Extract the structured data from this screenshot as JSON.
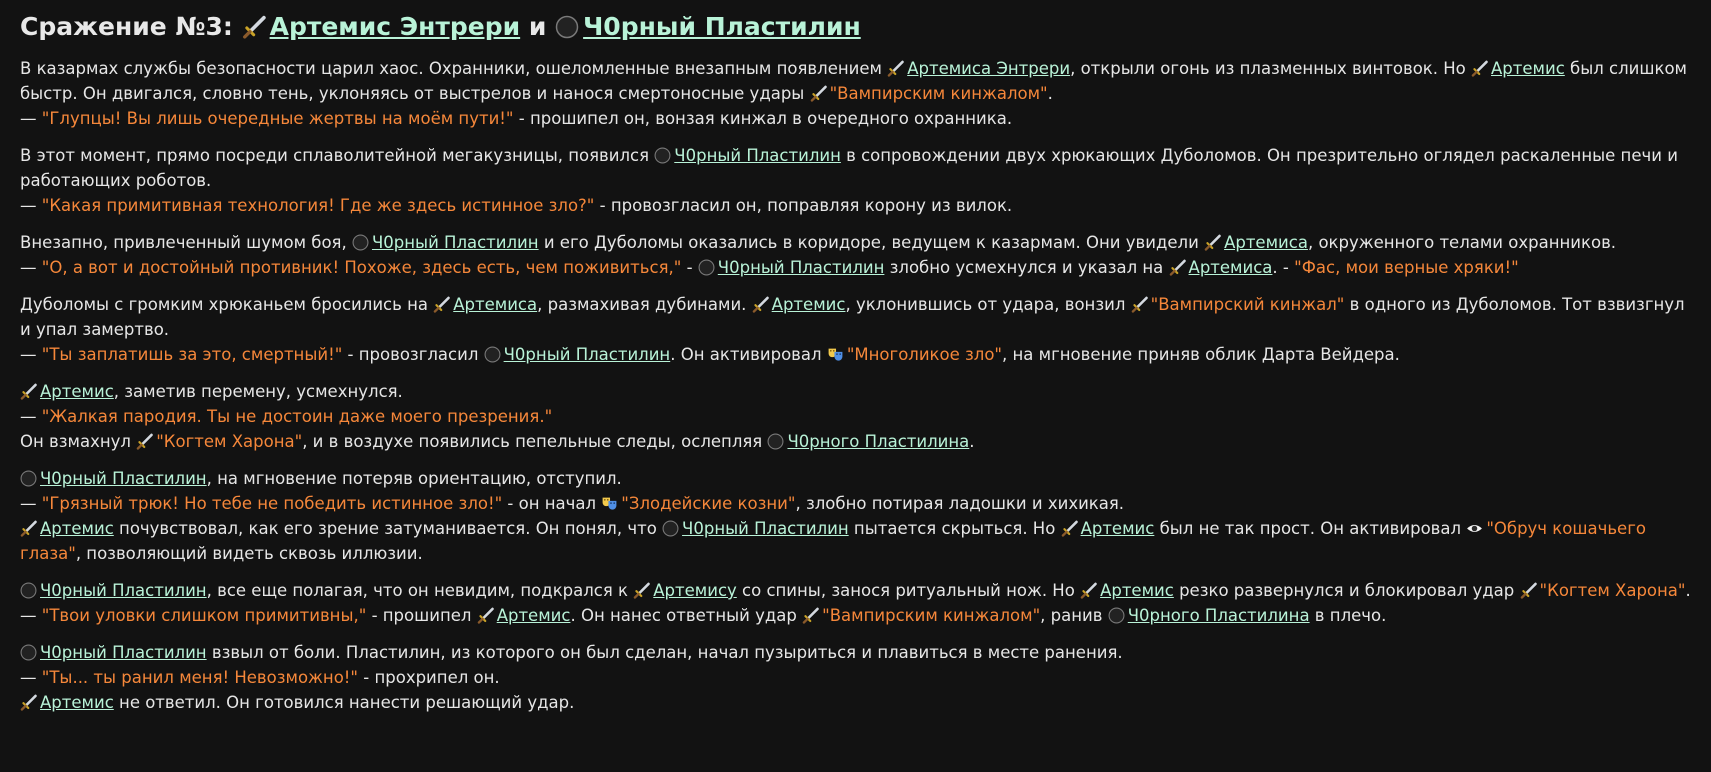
{
  "title": {
    "prefix": "Сражение №3:",
    "hero": "Артемис Энтрери",
    "and": "и",
    "villain": "Ч0рный Пластилин"
  },
  "paragraphs": [
    [
      [
        {
          "t": "В казармах службы безопасности царил хаос. Охранники, ошеломленные внезапным появлением "
        },
        {
          "t": "Артемиса Энтрери",
          "k": "link",
          "i": "dagger-icon"
        },
        {
          "t": ", открыли огонь из плазменных винтовок. Но "
        },
        {
          "t": "Артемис",
          "k": "link",
          "i": "dagger-icon"
        },
        {
          "t": " был слишком быстр. Он двигался, словно тень, уклоняясь от выстрелов и нанося смертоносные удары "
        },
        {
          "t": "\"Вампирским кинжалом\"",
          "k": "q",
          "i": "dagger-icon"
        },
        {
          "t": "."
        }
      ],
      [
        {
          "t": "— "
        },
        {
          "t": "\"Глупцы! Вы лишь очередные жертвы на моём пути!\"",
          "k": "q"
        },
        {
          "t": " - прошипел он, вонзая кинжал в очередного охранника."
        }
      ]
    ],
    [
      [
        {
          "t": "В этот момент, прямо посреди сплаволитейной мегакузницы, появился "
        },
        {
          "t": "Ч0рный Пластилин",
          "k": "link",
          "i": "black-circle-icon"
        },
        {
          "t": " в сопровождении двух хрюкающих Дуболомов. Он презрительно оглядел раскаленные печи и работающих роботов."
        }
      ],
      [
        {
          "t": "— "
        },
        {
          "t": "\"Какая примитивная технология! Где же здесь истинное зло?\"",
          "k": "q"
        },
        {
          "t": " - провозгласил он, поправляя корону из вилок."
        }
      ]
    ],
    [
      [
        {
          "t": "Внезапно, привлеченный шумом боя, "
        },
        {
          "t": "Ч0рный Пластилин",
          "k": "link",
          "i": "black-circle-icon"
        },
        {
          "t": " и его Дуболомы оказались в коридоре, ведущем к казармам. Они увидели "
        },
        {
          "t": "Артемиса",
          "k": "link",
          "i": "dagger-icon"
        },
        {
          "t": ", окруженного телами охранников."
        }
      ],
      [
        {
          "t": "— "
        },
        {
          "t": "\"О, а вот и достойный противник! Похоже, здесь есть, чем поживиться,\"",
          "k": "q"
        },
        {
          "t": " - "
        },
        {
          "t": "Ч0рный Пластилин",
          "k": "link",
          "i": "black-circle-icon"
        },
        {
          "t": " злобно усмехнулся и указал на "
        },
        {
          "t": "Артемиса",
          "k": "link",
          "i": "dagger-icon"
        },
        {
          "t": ". - "
        },
        {
          "t": "\"Фас, мои верные хряки!\"",
          "k": "q"
        }
      ]
    ],
    [
      [
        {
          "t": "Дуболомы с громким хрюканьем бросились на "
        },
        {
          "t": "Артемиса",
          "k": "link",
          "i": "dagger-icon"
        },
        {
          "t": ", размахивая дубинами. "
        },
        {
          "t": "Артемис",
          "k": "link",
          "i": "dagger-icon"
        },
        {
          "t": ", уклонившись от удара, вонзил "
        },
        {
          "t": "\"Вампирский кинжал\"",
          "k": "q",
          "i": "dagger-icon"
        },
        {
          "t": " в одного из Дуболомов. Тот взвизгнул и упал замертво."
        }
      ],
      [
        {
          "t": "— "
        },
        {
          "t": "\"Ты заплатишь за это, смертный!\"",
          "k": "q"
        },
        {
          "t": " - провозгласил "
        },
        {
          "t": "Ч0рный Пластилин",
          "k": "link",
          "i": "black-circle-icon"
        },
        {
          "t": ". Он активировал "
        },
        {
          "t": "\"Многоликое зло\"",
          "k": "q",
          "i": "theater-masks-icon"
        },
        {
          "t": ", на мгновение приняв облик Дарта Вейдера."
        }
      ]
    ],
    [
      [
        {
          "t": "Артемис",
          "k": "link",
          "i": "dagger-icon"
        },
        {
          "t": ", заметив перемену, усмехнулся."
        }
      ],
      [
        {
          "t": "— "
        },
        {
          "t": "\"Жалкая пародия. Ты не достоин даже моего презрения.\"",
          "k": "q"
        }
      ],
      [
        {
          "t": "Он взмахнул "
        },
        {
          "t": "\"Когтем Харона\"",
          "k": "q",
          "i": "dagger-icon"
        },
        {
          "t": ", и в воздухе появились пепельные следы, ослепляя "
        },
        {
          "t": "Ч0рного Пластилина",
          "k": "link",
          "i": "black-circle-icon"
        },
        {
          "t": "."
        }
      ]
    ],
    [
      [
        {
          "t": "Ч0рный Пластилин",
          "k": "link",
          "i": "black-circle-icon"
        },
        {
          "t": ", на мгновение потеряв ориентацию, отступил."
        }
      ],
      [
        {
          "t": "— "
        },
        {
          "t": "\"Грязный трюк! Но тебе не победить истинное зло!\"",
          "k": "q"
        },
        {
          "t": " - он начал "
        },
        {
          "t": "\"Злодейские козни\"",
          "k": "q",
          "i": "theater-masks-icon"
        },
        {
          "t": ", злобно потирая ладошки и хихикая."
        }
      ],
      [
        {
          "t": "Артемис",
          "k": "link",
          "i": "dagger-icon"
        },
        {
          "t": " почувствовал, как его зрение затуманивается. Он понял, что "
        },
        {
          "t": "Ч0рный Пластилин",
          "k": "link",
          "i": "black-circle-icon"
        },
        {
          "t": " пытается скрыться. Но "
        },
        {
          "t": "Артемис",
          "k": "link",
          "i": "dagger-icon"
        },
        {
          "t": " был не так прост. Он активировал "
        },
        {
          "t": "\"Обруч кошачьего глаза\"",
          "k": "q",
          "i": "eye-icon"
        },
        {
          "t": ", позволяющий видеть сквозь иллюзии."
        }
      ]
    ],
    [
      [
        {
          "t": "Ч0рный Пластилин",
          "k": "link",
          "i": "black-circle-icon"
        },
        {
          "t": ", все еще полагая, что он невидим, подкрался к "
        },
        {
          "t": "Артемису",
          "k": "link",
          "i": "dagger-icon"
        },
        {
          "t": " со спины, занося ритуальный нож. Но "
        },
        {
          "t": "Артемис",
          "k": "link",
          "i": "dagger-icon"
        },
        {
          "t": " резко развернулся и блокировал удар "
        },
        {
          "t": "\"Когтем Харона\"",
          "k": "q",
          "i": "dagger-icon"
        },
        {
          "t": "."
        }
      ],
      [
        {
          "t": "— "
        },
        {
          "t": "\"Твои уловки слишком примитивны,\"",
          "k": "q"
        },
        {
          "t": " - прошипел "
        },
        {
          "t": "Артемис",
          "k": "link",
          "i": "dagger-icon"
        },
        {
          "t": ". Он нанес ответный удар "
        },
        {
          "t": "\"Вампирским кинжалом\"",
          "k": "q",
          "i": "dagger-icon"
        },
        {
          "t": ", ранив "
        },
        {
          "t": "Ч0рного Пластилина",
          "k": "link",
          "i": "black-circle-icon"
        },
        {
          "t": " в плечо."
        }
      ]
    ],
    [
      [
        {
          "t": "Ч0рный Пластилин",
          "k": "link",
          "i": "black-circle-icon"
        },
        {
          "t": " взвыл от боли. Пластилин, из которого он был сделан, начал пузыриться и плавиться в месте ранения."
        }
      ],
      [
        {
          "t": "— "
        },
        {
          "t": "\"Ты... ты ранил меня! Невозможно!\"",
          "k": "q"
        },
        {
          "t": " - прохрипел он."
        }
      ],
      [
        {
          "t": "Артемис",
          "k": "link",
          "i": "dagger-icon"
        },
        {
          "t": " не ответил. Он готовился нанести решающий удар."
        }
      ]
    ]
  ],
  "colors": {
    "background": "#121212",
    "text": "#e6e6e6",
    "link": "#b9f3d8",
    "quote": "#f5873a"
  }
}
